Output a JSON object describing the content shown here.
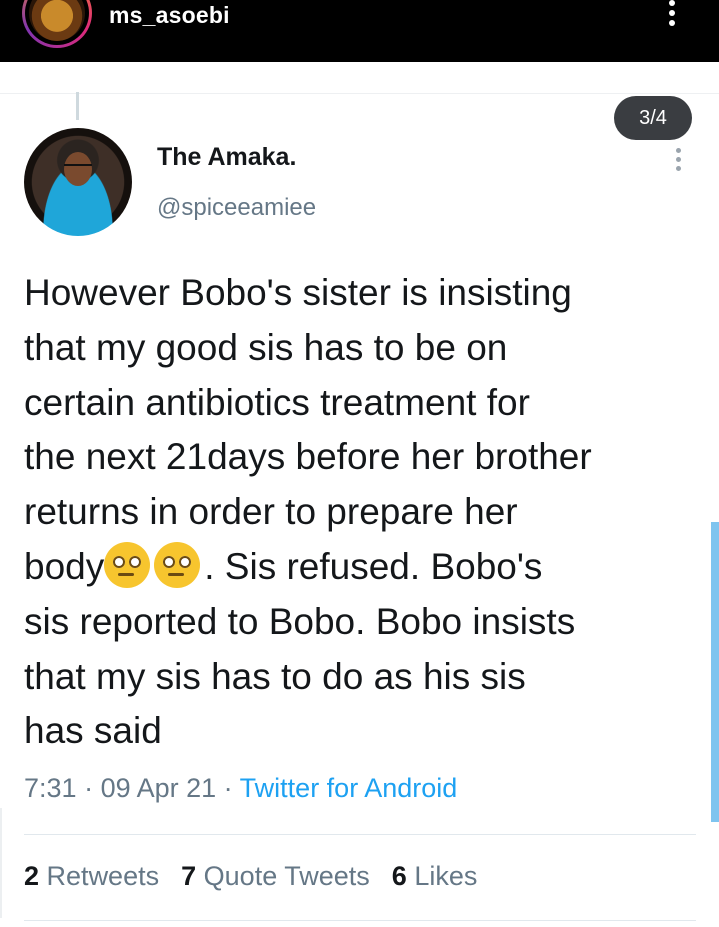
{
  "instagram": {
    "username": "ms_asoebi",
    "avatar_icon": "profile-avatar",
    "more_icon": "more-vertical-icon"
  },
  "tweet": {
    "counter": "3/4",
    "display_name": "The Amaka.",
    "handle": "@spiceeamiee",
    "text_lines": [
      "However Bobo's sister is insisting",
      "that my good sis has to be on",
      "certain antibiotics treatment for",
      "the next 21days before her brother",
      "returns in order to prepare her",
      "body",
      ". Sis refused. Bobo's",
      "sis reported to Bobo. Bobo insists",
      "that my sis has to do as his sis",
      "has said"
    ],
    "emoji": "face-with-rolling-eyes-emoji",
    "time": "7:31",
    "date": "09 Apr 21",
    "source": "Twitter for Android",
    "separator": " · ",
    "stats": {
      "retweets_count": "2",
      "retweets_label": "Retweets",
      "quotes_count": "7",
      "quotes_label": "Quote Tweets",
      "likes_count": "6",
      "likes_label": "Likes"
    }
  },
  "colors": {
    "link": "#1da1f2",
    "secondary_text": "#657786",
    "primary_text": "#14171a"
  }
}
